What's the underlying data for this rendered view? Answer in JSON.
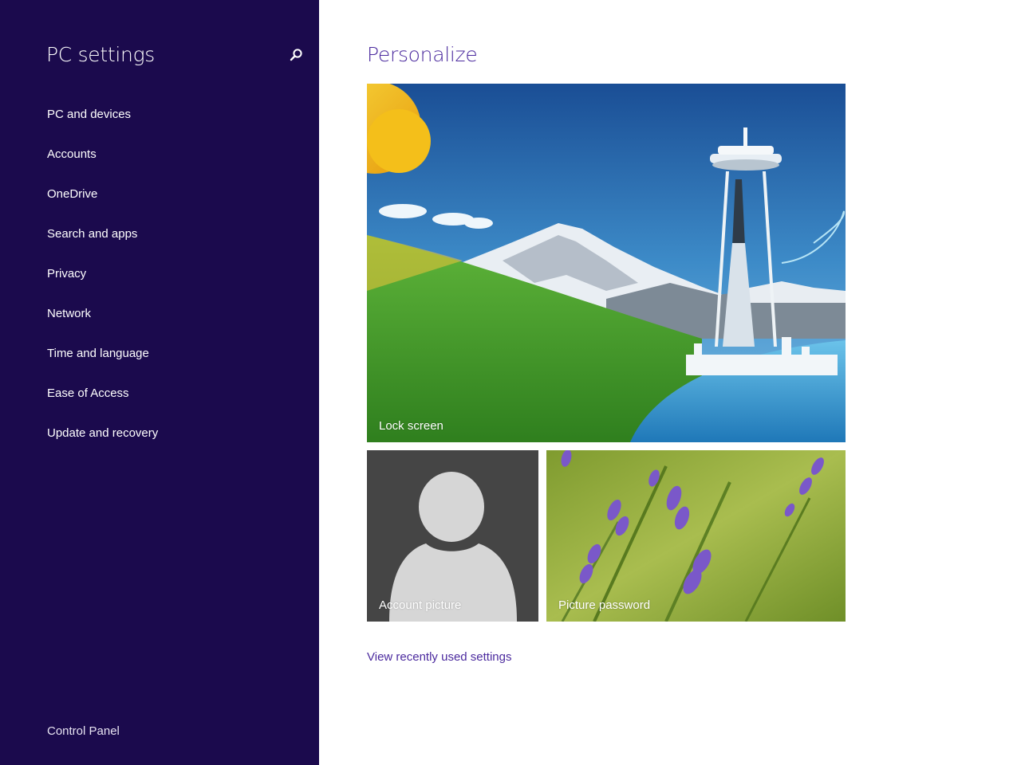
{
  "sidebar": {
    "title": "PC settings",
    "search_icon": "search-icon",
    "items": [
      {
        "label": "PC and devices"
      },
      {
        "label": "Accounts"
      },
      {
        "label": "OneDrive"
      },
      {
        "label": "Search and apps"
      },
      {
        "label": "Privacy"
      },
      {
        "label": "Network"
      },
      {
        "label": "Time and language"
      },
      {
        "label": "Ease of Access"
      },
      {
        "label": "Update and recovery"
      }
    ],
    "control_panel": "Control Panel"
  },
  "main": {
    "title": "Personalize",
    "tiles": {
      "lock_screen": "Lock screen",
      "account_picture": "Account picture",
      "picture_password": "Picture password"
    },
    "recent_link": "View recently used settings"
  },
  "colors": {
    "sidebar_bg": "#1b0a4d",
    "accent": "#4b2a9e"
  }
}
